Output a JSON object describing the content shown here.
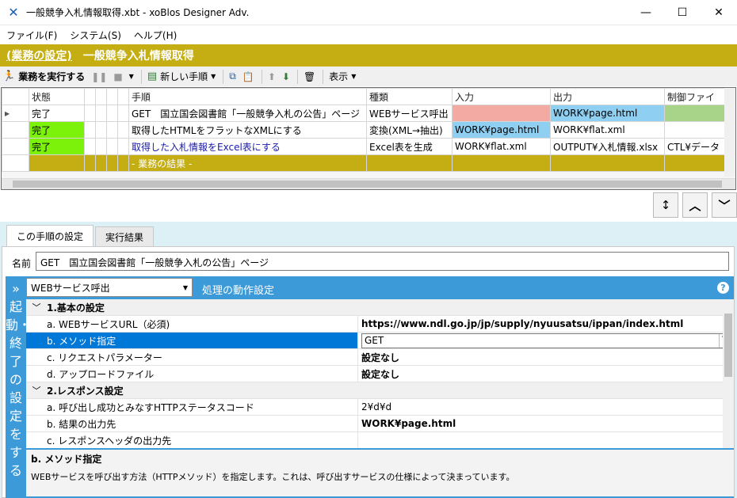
{
  "window": {
    "title": "一般競争入札情報取得.xbt - xoBlos Designer Adv.",
    "minimize": "—",
    "maximize": "☐",
    "close": "✕"
  },
  "menu": [
    "ファイル(F)",
    "システム(S)",
    "ヘルプ(H)"
  ],
  "banner": {
    "breadcrumb": "(業務の設定)",
    "title": "一般競争入札情報取得"
  },
  "toolbar": {
    "run": "業務を実行する",
    "new_step": "新しい手順",
    "view": "表示"
  },
  "grid": {
    "headers": [
      "状態",
      "手順",
      "種類",
      "入力",
      "出力",
      "制御ファイ"
    ],
    "rows": [
      {
        "status": "完了",
        "step": "GET　国立国会図書館「一般競争入札の公告」ページ",
        "kind": "WEBサービス呼出",
        "input": "",
        "output": "WORK¥page.html",
        "control": ""
      },
      {
        "status": "完了",
        "step": "取得したHTMLをフラットなXMLにする",
        "kind": "変換(XML→抽出)",
        "input": "WORK¥page.html",
        "output": "WORK¥flat.xml",
        "control": ""
      },
      {
        "status": "完了",
        "step": "取得した入札情報をExcel表にする",
        "kind": "Excel表を生成",
        "input": "WORK¥flat.xml",
        "output": "OUTPUT¥入札情報.xlsx",
        "control": "CTL¥データ"
      }
    ],
    "result_row": "- 業務の結果 -"
  },
  "tabs": [
    "この手順の設定",
    "実行結果"
  ],
  "name": {
    "label": "名前",
    "value": "GET　国立国会図書館「一般競争入札の公告」ページ"
  },
  "side_label": "» 起動・終了の設定をする",
  "ops": {
    "select": "WEBサービス呼出",
    "title": "処理の動作設定",
    "help": "?"
  },
  "groups": [
    {
      "title": "1.基本の設定",
      "props": [
        {
          "name": "a. WEBサービスURL（必須)",
          "value": "https://www.ndl.go.jp/jp/supply/nyuusatsu/ippan/index.html"
        },
        {
          "name": "b. メソッド指定",
          "value": "GET"
        },
        {
          "name": "c. リクエストパラメーター",
          "value": "設定なし"
        },
        {
          "name": "d. アップロードファイル",
          "value": "設定なし"
        }
      ]
    },
    {
      "title": "2.レスポンス設定",
      "props": [
        {
          "name": "a. 呼び出し成功とみなすHTTPステータスコード",
          "value": "2¥d¥d"
        },
        {
          "name": "b. 結果の出力先",
          "value": "WORK¥page.html"
        },
        {
          "name": "c. レスポンスヘッダの出力先",
          "value": ""
        }
      ]
    }
  ],
  "description": {
    "title": "b. メソッド指定",
    "text": "WEBサービスを呼び出す方法（HTTPメソッド）を指定します。これは、呼び出すサービスの仕様によって決まっています。"
  },
  "colors": {
    "banner": "#c4ae13",
    "done": "#7cf20b",
    "accent": "#3d9ad9",
    "selection": "#0078d7"
  },
  "icons": [
    "app-logo-icon",
    "run-icon",
    "pause-icon",
    "stop-icon",
    "new-step-icon",
    "copy-icon",
    "paste-icon",
    "up-arrow-icon",
    "down-arrow-icon",
    "trash-icon",
    "help-icon"
  ]
}
